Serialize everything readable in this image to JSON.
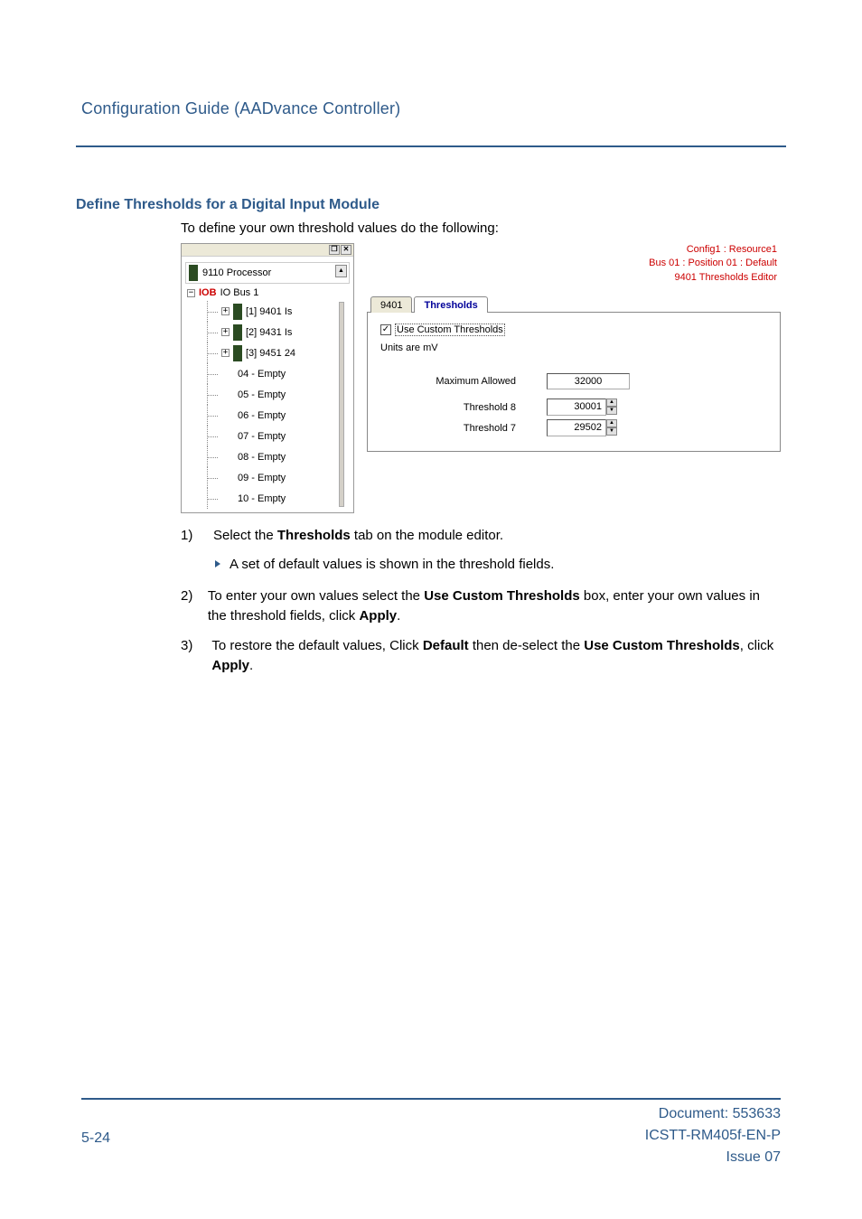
{
  "header": {
    "title": "Configuration Guide (AADvance Controller)"
  },
  "section": {
    "heading": "Define Thresholds for a Digital Input Module",
    "intro": "To define your own threshold values do the following:"
  },
  "tree": {
    "processor": "9110 Processor",
    "bus_prefix": "IOB",
    "bus_label": "IO Bus 1",
    "slots": [
      "[1] 9401 Is",
      "[2] 9431 Is",
      "[3] 9451 24",
      "04 - Empty",
      "05 - Empty",
      "06 - Empty",
      "07 - Empty",
      "08 - Empty",
      "09 - Empty",
      "10 - Empty"
    ]
  },
  "editor": {
    "context1": "Config1 : Resource1",
    "context2": "Bus 01 : Position 01 : Default",
    "context3": "9401 Thresholds Editor",
    "tab_main": "9401",
    "tab_active": "Thresholds",
    "use_custom": "Use Custom Thresholds",
    "units": "Units are mV",
    "max_label": "Maximum Allowed",
    "max_value": "32000",
    "t8_label": "Threshold 8",
    "t8_value": "30001",
    "t7_label": "Threshold 7",
    "t7_value": "29502"
  },
  "steps": {
    "s1_num": "1)",
    "s1a": "Select the ",
    "s1b": "Thresholds",
    "s1c": " tab on the module editor.",
    "s1_sub": "A set of default values is shown in the threshold fields.",
    "s2_num": "2)",
    "s2a": "To enter your own values select the ",
    "s2b": "Use Custom Thresholds",
    "s2c": " box, enter your own values in the threshold fields, click ",
    "s2d": "Apply",
    "s2e": ".",
    "s3_num": "3)",
    "s3a": "To restore the default values, Click ",
    "s3b": "Default",
    "s3c": " then de-select the ",
    "s3d": "Use Custom Thresholds",
    "s3e": ", click ",
    "s3f": "Apply",
    "s3g": "."
  },
  "footer": {
    "left": "5-24",
    "r1": "Document: 553633",
    "r2": "ICSTT-RM405f-EN-P",
    "r3": "Issue 07"
  }
}
